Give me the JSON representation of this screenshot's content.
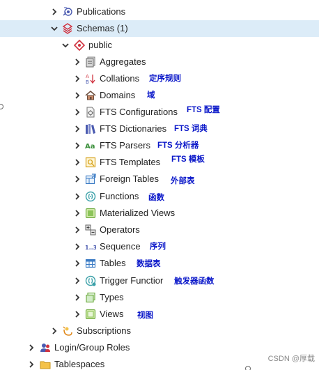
{
  "tree": {
    "publications": "Publications",
    "schemas": "Schemas (1)",
    "public": "public",
    "items": [
      {
        "label": "Aggregates",
        "note": ""
      },
      {
        "label": "Collations",
        "note": "定序规则"
      },
      {
        "label": "Domains",
        "note": "域"
      },
      {
        "label": "FTS Configurations",
        "note": "FTS 配置"
      },
      {
        "label": "FTS Dictionaries",
        "note": "FTS 词典"
      },
      {
        "label": "FTS Parsers",
        "note": "FTS 分析器"
      },
      {
        "label": "FTS Templates",
        "note": "FTS 模板"
      },
      {
        "label": "Foreign Tables",
        "note": "外部表"
      },
      {
        "label": "Functions",
        "note": "函数"
      },
      {
        "label": "Materialized Views",
        "note": ""
      },
      {
        "label": "Operators",
        "note": ""
      },
      {
        "label": "Sequence",
        "note": "序列"
      },
      {
        "label": "Tables",
        "note": "数据表"
      },
      {
        "label": "Trigger Functior",
        "note": "触发器函数"
      },
      {
        "label": "Types",
        "note": ""
      },
      {
        "label": "Views",
        "note": "视图"
      }
    ],
    "subscriptions": "Subscriptions",
    "login_roles": "Login/Group Roles",
    "tablespaces": "Tablespaces"
  },
  "watermark": "CSDN @厚载",
  "colors": {
    "selected_bg": "#dcecf8",
    "annotation": "#0a17c9",
    "schema_icon": "#d0323f"
  }
}
